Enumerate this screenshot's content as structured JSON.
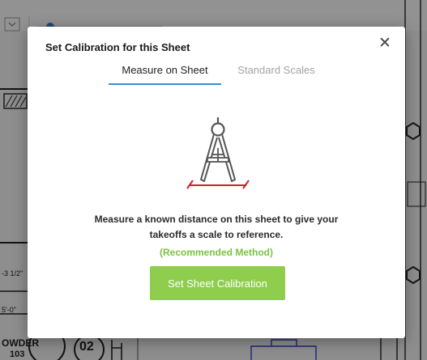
{
  "background": {
    "labels": {
      "dim_a": "-3 1/2\"",
      "dim_b": "5'-0\"",
      "room_name": "OWDER",
      "room_number": "103",
      "tag": "02"
    }
  },
  "modal": {
    "title": "Set Calibration for this Sheet",
    "close_glyph": "✕",
    "tabs": [
      {
        "label": "Measure on Sheet",
        "active": true
      },
      {
        "label": "Standard Scales",
        "active": false
      }
    ],
    "illustration_icon": "drafting-compass-icon",
    "description": "Measure a known distance on this sheet to give your takeoffs a scale to reference.",
    "recommended": "(Recommended Method)",
    "primary_button": "Set Sheet Calibration"
  },
  "colors": {
    "accent_blue": "#2f8fd8",
    "green": "#7ac242",
    "button_green": "#8fcd4d",
    "measure_red": "#d0202a"
  }
}
